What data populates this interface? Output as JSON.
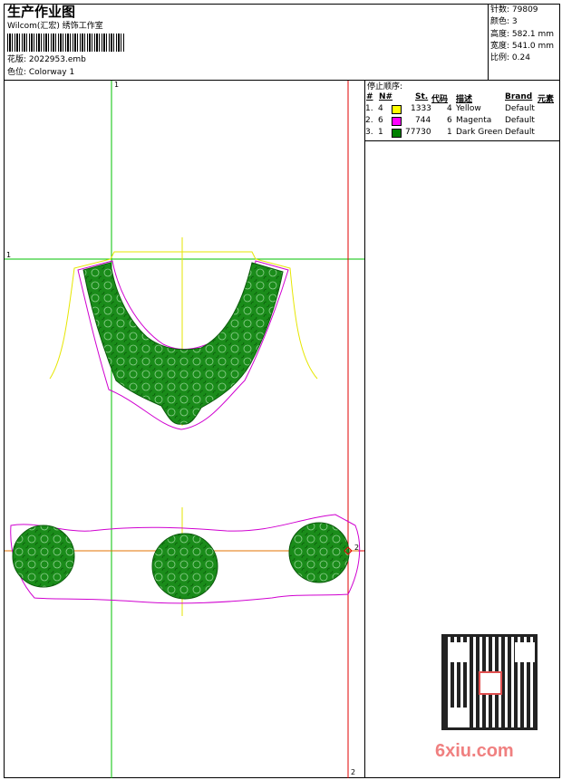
{
  "header": {
    "title": "生产作业图",
    "company": "Wilcom(汇宏) 绣饰工作室",
    "design_label": "花版: 2022953.emb",
    "colorway_label": "色位: Colorway 1"
  },
  "stats": {
    "stitches": "针数: 79809",
    "colors": "颜色: 3",
    "height": "高度: 582.1 mm",
    "width": "宽度: 541.0 mm",
    "scale": "比例: 0.24"
  },
  "stop_sequence": {
    "title": "停止顺序:",
    "columns": {
      "num": "#",
      "n": "N#",
      "st": "St.",
      "code": "代码",
      "desc": "描述",
      "brand": "Brand",
      "element": "元素"
    },
    "rows": [
      {
        "num": "1.",
        "n": "4",
        "color": "#ffff00",
        "st": "1333",
        "code": "4",
        "desc": "Yellow",
        "brand": "Default"
      },
      {
        "num": "2.",
        "n": "6",
        "color": "#ff00ff",
        "st": "744",
        "code": "6",
        "desc": "Magenta",
        "brand": "Default"
      },
      {
        "num": "3.",
        "n": "1",
        "color": "#008000",
        "st": "77730",
        "code": "1",
        "desc": "Dark Green",
        "brand": "Default"
      }
    ]
  },
  "guides": {
    "v_marker_top": "1",
    "h_marker_left": "1",
    "h_marker_right": "2",
    "v_marker_bottom": "2"
  },
  "watermark": {
    "site": "6xiu.com"
  },
  "colors": {
    "green": "#1a8c1a",
    "guide_green": "#00c000",
    "guide_red": "#e00000",
    "yellow": "#e6e600",
    "magenta": "#d000d0"
  }
}
